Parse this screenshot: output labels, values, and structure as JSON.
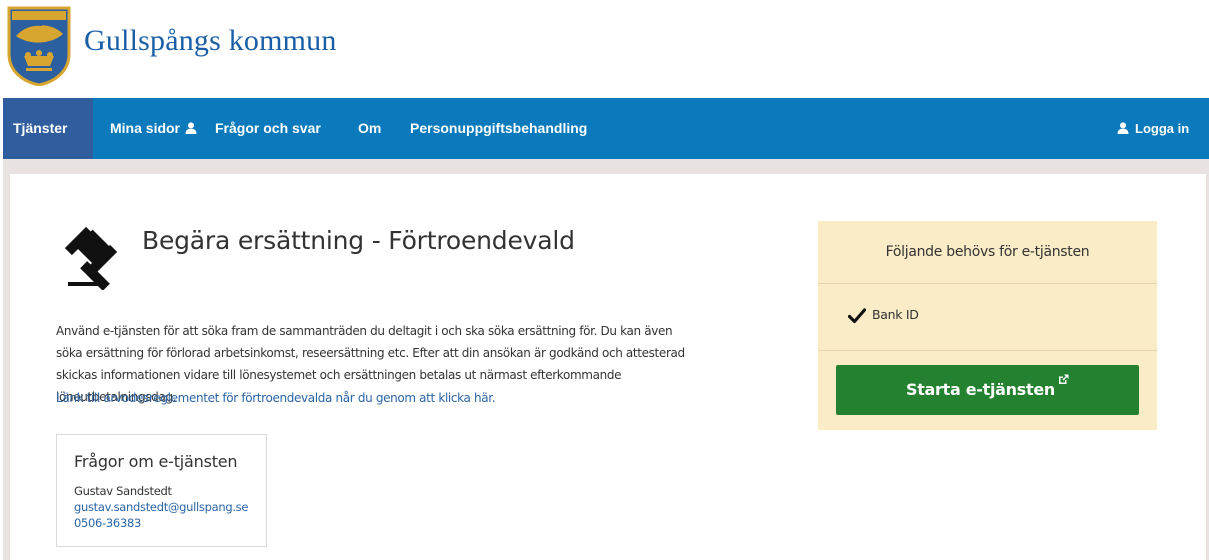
{
  "site": {
    "name": "Gullspångs kommun"
  },
  "nav": {
    "items": [
      {
        "label": "Tjänster"
      },
      {
        "label": "Mina sidor"
      },
      {
        "label": "Frågor och svar"
      },
      {
        "label": "Om"
      },
      {
        "label": "Personuppgiftsbehandling"
      }
    ],
    "login_label": "Logga in"
  },
  "service": {
    "title": "Begära ersättning - Förtroendevald",
    "description": "Använd e-tjänsten för att söka fram de sammanträden du deltagit i och ska söka ersättning för. Du kan även söka ersättning för förlorad arbetsinkomst, reseersättning etc. Efter att din ansökan är godkänd och attesterad skickas informationen vidare till lönesystemet och ersättningen betalas ut närmast efterkommande löneutbetalningsdag.",
    "link_text": "Länk till arvodesreglementet för förtroendevalda når du genom att klicka här."
  },
  "contact": {
    "title": "Frågor om e-tjänsten",
    "name": "Gustav Sandstedt",
    "email": "gustav.sandstedt@gullspang.se",
    "phone": "0506-36383"
  },
  "requirements": {
    "heading": "Följande behövs för e-tjänsten",
    "items": [
      {
        "label": "Bank ID"
      }
    ],
    "start_button": "Starta e-tjänsten"
  },
  "colors": {
    "nav_bg": "#0a7abc",
    "nav_active": "#2f5d9e",
    "req_bg": "#fbecc8",
    "button_green": "#24812f",
    "link_blue": "#2a65a6"
  },
  "icons": {
    "logo": "municipal-coat-of-arms",
    "user": "user-icon",
    "service": "gavel-icon",
    "check": "checkmark-icon",
    "external": "external-link-icon"
  }
}
